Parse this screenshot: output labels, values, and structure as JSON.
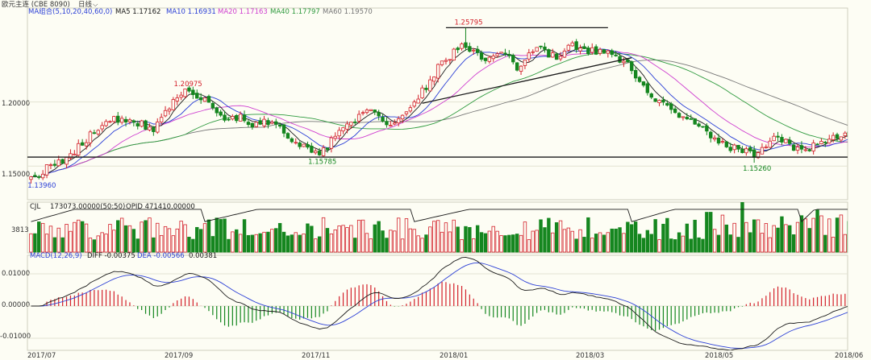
{
  "header": {
    "symbol": "欧元主连 (CBE 8090)",
    "period": "日线",
    "ma_title": "MA组合(5,10,20,40,60,0)",
    "ma_labels": [
      {
        "text": "MA5 1.17162",
        "color": "#1a1a1a"
      },
      {
        "text": "MA10 1.16931",
        "color": "#2b3fd6"
      },
      {
        "text": "MA20 1.17163",
        "color": "#cf3fd0"
      },
      {
        "text": "MA40 1.17797",
        "color": "#2e9a3e"
      },
      {
        "text": "MA60 1.19570",
        "color": "#777777"
      }
    ]
  },
  "volume_header": {
    "title": "CJL",
    "cjl": "173073.00000(50:50)",
    "opid": "OPID 471410.00000"
  },
  "macd_header": {
    "title": "MACD(12,26,9)",
    "diff": "DIFF -0.00375",
    "dea": "DEA -0.00566",
    "macd": "0.00381"
  },
  "colors": {
    "bull": "#d3202a",
    "bear": "#15861f",
    "ma5": "#1a1a1a",
    "ma10": "#2b3fd6",
    "ma20": "#cf3fd0",
    "ma40": "#2e9a3e",
    "ma60": "#777777",
    "dea": "#2b3fd6",
    "diff": "#1a1a1a",
    "trendline": "#1a1a1a"
  },
  "chart_data": {
    "type": "candlestick",
    "x_tick_labels": [
      "2017/07",
      "2017/09",
      "2017/11",
      "2018/01",
      "2018/03",
      "2018/05",
      "2018/06"
    ],
    "price_axis_ticks": [
      "1.20000",
      "1.15000"
    ],
    "price_ylim": [
      1.125,
      1.272
    ],
    "volume_axis_ticks": [
      "3813"
    ],
    "macd_axis_ticks": [
      "0.01000",
      "0.00000",
      "-0.01000"
    ],
    "macd_ylim": [
      -0.0135,
      0.0155
    ],
    "annotations": [
      {
        "text": "1.25795",
        "color": "#d3202a",
        "value": 1.25795,
        "index": 110
      },
      {
        "text": "1.20975",
        "color": "#d3202a",
        "value": 1.20975,
        "index": 39
      },
      {
        "text": "1.15785",
        "color": "#15861f",
        "value": 1.15785,
        "index": 73
      },
      {
        "text": "1.15260",
        "color": "#15861f",
        "value": 1.1526,
        "index": 183
      },
      {
        "text": "1.13960",
        "color": "#2b3fd6",
        "value": 1.1396,
        "index": 2
      }
    ],
    "trendlines": [
      {
        "from": [
          105,
          1.25795
        ],
        "to": [
          146,
          1.25795
        ]
      },
      {
        "from": [
          99,
          1.199
        ],
        "to": [
          152,
          1.2345
        ]
      }
    ],
    "support_level": 1.157,
    "anchors": [
      [
        0,
        1.14
      ],
      [
        4,
        1.148
      ],
      [
        10,
        1.158
      ],
      [
        16,
        1.178
      ],
      [
        21,
        1.186
      ],
      [
        26,
        1.185
      ],
      [
        31,
        1.178
      ],
      [
        36,
        1.2
      ],
      [
        39,
        1.207
      ],
      [
        44,
        1.201
      ],
      [
        49,
        1.186
      ],
      [
        53,
        1.189
      ],
      [
        57,
        1.182
      ],
      [
        61,
        1.185
      ],
      [
        66,
        1.172
      ],
      [
        70,
        1.162
      ],
      [
        73,
        1.16
      ],
      [
        78,
        1.175
      ],
      [
        81,
        1.183
      ],
      [
        86,
        1.195
      ],
      [
        91,
        1.183
      ],
      [
        95,
        1.192
      ],
      [
        100,
        1.212
      ],
      [
        104,
        1.232
      ],
      [
        110,
        1.245
      ],
      [
        114,
        1.233
      ],
      [
        119,
        1.24
      ],
      [
        123,
        1.228
      ],
      [
        128,
        1.241
      ],
      [
        133,
        1.236
      ],
      [
        137,
        1.244
      ],
      [
        141,
        1.239
      ],
      [
        146,
        1.242
      ],
      [
        152,
        1.226
      ],
      [
        157,
        1.203
      ],
      [
        162,
        1.193
      ],
      [
        166,
        1.189
      ],
      [
        171,
        1.178
      ],
      [
        175,
        1.166
      ],
      [
        180,
        1.162
      ],
      [
        183,
        1.159
      ],
      [
        187,
        1.171
      ],
      [
        191,
        1.168
      ],
      [
        195,
        1.162
      ],
      [
        199,
        1.167
      ],
      [
        203,
        1.172
      ],
      [
        206,
        1.175
      ]
    ]
  }
}
